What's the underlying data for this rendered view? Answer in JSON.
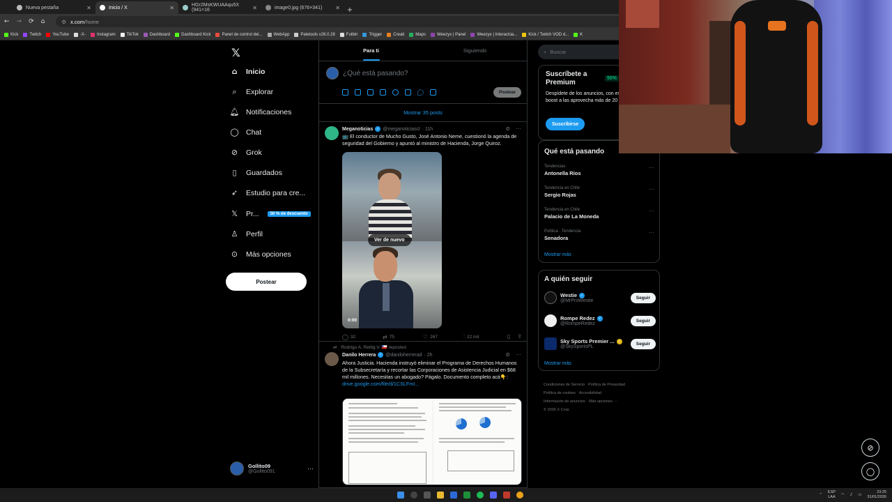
{
  "browser": {
    "tabs": [
      {
        "label": "Nueva pestaña",
        "active": false
      },
      {
        "label": "Inicio / X",
        "active": true
      },
      {
        "label": "HGr2MsKWUAAqu5X (941×16",
        "active": false
      },
      {
        "label": "image0.jpg (676×341)",
        "active": false
      }
    ],
    "url_host": "x.com",
    "url_path": "/home",
    "bookmarks": [
      "Kick",
      "Twitch",
      "YouTube",
      "-X-",
      "Instagram",
      "TikTok",
      "Dashboard",
      "Dashboard Kick",
      "Panel de control del...",
      "WebApp",
      "Paletools v26.0.28",
      "Futbin",
      "Trigger",
      "Creati",
      "Maps",
      "Weezyx | Panel",
      "Weezyx | Interactúa...",
      "Kick / Twitch VOD d...",
      "K"
    ]
  },
  "nav": {
    "items": [
      {
        "label": "Inicio",
        "icon": "home-icon"
      },
      {
        "label": "Explorar",
        "icon": "search-icon"
      },
      {
        "label": "Notificaciones",
        "icon": "bell-icon"
      },
      {
        "label": "Chat",
        "icon": "chat-icon"
      },
      {
        "label": "Grok",
        "icon": "grok-icon"
      },
      {
        "label": "Guardados",
        "icon": "bookmark-icon"
      },
      {
        "label": "Estudio para cre...",
        "icon": "rocket-icon"
      },
      {
        "label": "Pr...",
        "icon": "x-icon"
      },
      {
        "label": "Perfil",
        "icon": "person-icon"
      },
      {
        "label": "Más opciones",
        "icon": "more-circle-icon"
      }
    ],
    "premium_badge": "50 % de descuento",
    "post_button": "Postear",
    "account_name": "Gollito09",
    "account_handle": "@Gollito091"
  },
  "main": {
    "tabs": [
      "Para ti",
      "Siguiendo"
    ],
    "composer_placeholder": "¿Qué está pasando?",
    "composer_post": "Postear",
    "show_more": "Mostrar 35 posts",
    "tweet1": {
      "name": "Meganoticias",
      "handle": "@meganoticiascl",
      "time": "· 11h",
      "text": "📺 El conductor de Mucho Gusto, José Antonio Neme, cuestionó la agenda de seguridad del Gobierno y apuntó al ministro de Hacienda, Jorge Quiroz.",
      "replay": "Ver de nuevo",
      "video_time": "0:00",
      "replies": "32",
      "reposts": "75",
      "likes": "267",
      "views": "22 mil"
    },
    "tweet2": {
      "repost_by": "Rodrigo A. Rettig V. 🇨🇱 reposteó",
      "name": "Danilo Herrera",
      "handle": "@daniloherrerad",
      "time": "· 2h",
      "text": "Ahora Justicia. Hacienda instruyó eliminar el Programa de Derechos Humanos de la Subsecretaría y recortar las Corporaciones de Asistencia Judicial en $68 mil millones. Necesitas un abogado? Págalo. Documento completo acá👇:",
      "link": "drive.google.com/file/d/1CSLFmI..."
    }
  },
  "right": {
    "search_placeholder": "Buscar",
    "premium_title": "Suscríbete a Premium",
    "premium_pct": "50%",
    "premium_desc": "Despídete de los anuncios, con estadísticas, aplica boost a las aprovecha más de 20 caracterí",
    "premium_button": "Suscribirse",
    "trends_title": "Qué está pasando",
    "trends": [
      {
        "context": "Tendencias",
        "name": "Antonella Ríos"
      },
      {
        "context": "Tendencia en Chile",
        "name": "Sergio Rojas"
      },
      {
        "context": "Tendencia en Chile",
        "name": "Palacio de La Moneda"
      },
      {
        "context": "Política · Tendencia",
        "name": "Senadora"
      }
    ],
    "show_more": "Mostrar más",
    "follow_title": "A quién seguir",
    "follow": [
      {
        "name": "Westie",
        "handle": "@MrProWestie",
        "button": "Seguir"
      },
      {
        "name": "Rompe Redez",
        "handle": "@RompeRedez",
        "button": "Seguir"
      },
      {
        "name": "Sky Sports Premier ...",
        "handle": "@SkySportsPL",
        "button": "Seguir"
      }
    ],
    "follow_more": "Mostrar más",
    "footer": [
      "Condiciones de Servicio",
      "Política de Privacidad",
      "Política de cookies",
      "Accesibilidad",
      "Información de anuncios",
      "Más opciones ···",
      "© 2026 X Corp."
    ]
  },
  "taskbar": {
    "lang_top": "ESP",
    "lang_bottom": "LAA",
    "time": "23:25",
    "date": "31/01/2026"
  }
}
